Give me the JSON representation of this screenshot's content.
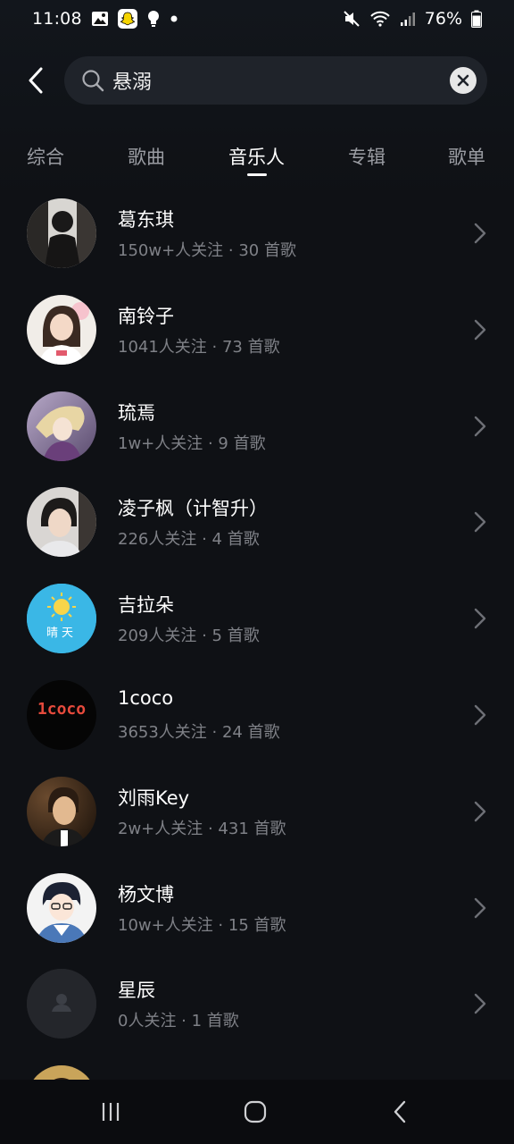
{
  "status_bar": {
    "time": "11:08",
    "battery": "76%",
    "icons": [
      "image-icon",
      "snapchat-icon",
      "bulb-icon",
      "dot-icon",
      "mute-icon",
      "wifi-icon",
      "signal-icon",
      "battery-icon"
    ]
  },
  "search": {
    "query": "悬溺",
    "back_icon": "chevron-left-icon",
    "search_icon": "search-icon",
    "clear_icon": "close-circle-icon"
  },
  "tabs": [
    {
      "label": "综合",
      "active": false
    },
    {
      "label": "歌曲",
      "active": false
    },
    {
      "label": "音乐人",
      "active": true
    },
    {
      "label": "专辑",
      "active": false
    },
    {
      "label": "歌单",
      "active": false
    }
  ],
  "artists": [
    {
      "name": "葛东琪",
      "meta": "150w+人关注 · 30 首歌"
    },
    {
      "name": "南铃子",
      "meta": "1041人关注 · 73 首歌"
    },
    {
      "name": "琉焉",
      "meta": "1w+人关注 · 9 首歌"
    },
    {
      "name": "凌子枫（计智升）",
      "meta": "226人关注 · 4 首歌"
    },
    {
      "name": "吉拉朵",
      "meta": "209人关注 · 5 首歌",
      "avatar_text": "晴天"
    },
    {
      "name": "1coco",
      "meta": "3653人关注 · 24 首歌",
      "avatar_text": "1coco"
    },
    {
      "name": "刘雨Key",
      "meta": "2w+人关注 · 431 首歌"
    },
    {
      "name": "杨文博",
      "meta": "10w+人关注 · 15 首歌"
    },
    {
      "name": "星辰",
      "meta": "0人关注 · 1 首歌"
    },
    {
      "name": "",
      "meta": ""
    }
  ],
  "colors": {
    "background": "#0f1115",
    "search_bg": "#1f232a",
    "secondary_text": "#7f8187",
    "tab_inactive": "#9a9ca2"
  },
  "nav_bar": {
    "icons": [
      "recents-icon",
      "home-icon",
      "back-icon"
    ]
  }
}
